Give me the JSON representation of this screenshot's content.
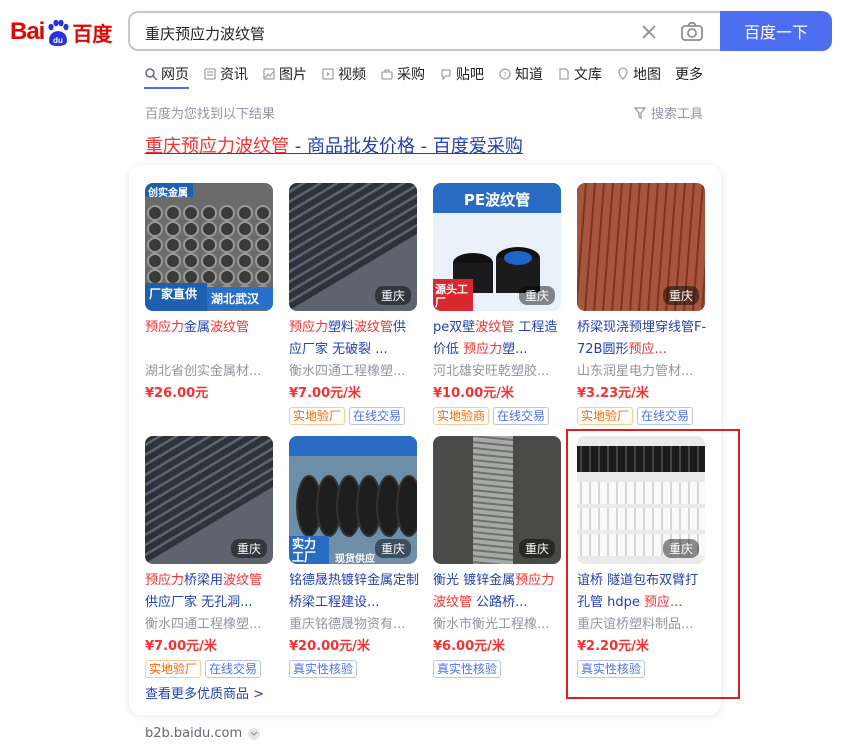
{
  "logo": {
    "bai": "Bai",
    "du": "du",
    "cn": "百度"
  },
  "search": {
    "query": "重庆预应力波纹管",
    "button": "百度一下"
  },
  "tabs": [
    {
      "label": "网页",
      "icon": "search-icon"
    },
    {
      "label": "资讯",
      "icon": "news-icon"
    },
    {
      "label": "图片",
      "icon": "image-icon"
    },
    {
      "label": "视频",
      "icon": "video-icon"
    },
    {
      "label": "采购",
      "icon": "bag-icon"
    },
    {
      "label": "贴吧",
      "icon": "tieba-icon"
    },
    {
      "label": "知道",
      "icon": "question-icon"
    },
    {
      "label": "文库",
      "icon": "doc-icon"
    },
    {
      "label": "地图",
      "icon": "map-icon"
    },
    {
      "label": "更多",
      "icon": ""
    }
  ],
  "results_info": {
    "count_text": "百度为您找到以下结果",
    "tools": "搜索工具"
  },
  "result": {
    "title_hl": "重庆预应力波纹管",
    "title_rest": " - 商品批发价格 - 百度爱采购",
    "more_link": "查看更多优质商品 >",
    "source": "b2b.baidu.com"
  },
  "products": [
    {
      "title": [
        [
          "预应力",
          "hl"
        ],
        [
          "金属",
          ""
        ],
        [
          "波纹管",
          "hl"
        ]
      ],
      "shop": "湖北省创实金属材...",
      "price": "¥26.00元",
      "location": "",
      "overlay_left": "厂家直供",
      "overlay_right": "湖北武汉",
      "corner": "创实金属",
      "badges": []
    },
    {
      "title": [
        [
          "预应力",
          "hl"
        ],
        [
          "塑料",
          ""
        ],
        [
          "波纹管",
          "hl"
        ],
        [
          "供应厂家 无破裂 ...",
          ""
        ]
      ],
      "shop": "衡水四通工程橡塑...",
      "price": "¥7.00元/米",
      "location": "重庆",
      "badges": [
        [
          "实地验厂",
          "orange"
        ],
        [
          "在线交易",
          "blue"
        ]
      ]
    },
    {
      "title": [
        [
          "pe双壁",
          ""
        ],
        [
          "波纹管",
          "hl"
        ],
        [
          " 工程造价低 ",
          ""
        ],
        [
          "预应力",
          "hl"
        ],
        [
          "塑...",
          ""
        ]
      ],
      "shop": "河北雄安旺乾塑胶...",
      "price": "¥10.00元/米",
      "location": "重庆",
      "pe_label": "PE波纹管",
      "overlay_left": "源头工厂",
      "badges": [
        [
          "实地验商",
          "orange"
        ],
        [
          "在线交易",
          "blue"
        ]
      ]
    },
    {
      "title": [
        [
          "桥梁现浇预埋穿线管F-72B圆形",
          ""
        ],
        [
          "预应...",
          "hl"
        ]
      ],
      "shop": "山东润星电力管材...",
      "price": "¥3.23元/米",
      "location": "重庆",
      "badges": [
        [
          "实地验厂",
          "orange"
        ],
        [
          "在线交易",
          "blue"
        ]
      ]
    },
    {
      "title": [
        [
          "预应力",
          "hl"
        ],
        [
          "桥梁用",
          ""
        ],
        [
          "波纹管",
          "hl"
        ],
        [
          "供应厂家 无孔洞...",
          ""
        ]
      ],
      "shop": "衡水四通工程橡塑...",
      "price": "¥7.00元/米",
      "location": "重庆",
      "badges": [
        [
          "实地验厂",
          "orange"
        ],
        [
          "在线交易",
          "blue"
        ]
      ]
    },
    {
      "title": [
        [
          "铭德晟热镀锌金属定制 桥梁工程建设...",
          ""
        ]
      ],
      "shop": "重庆铭德晟物资有...",
      "price": "¥20.00元/米",
      "location": "重庆",
      "overlay_left": "实力工厂",
      "overlay_bottom": "现货供应",
      "badges": [
        [
          "真实性核验",
          "blue"
        ]
      ]
    },
    {
      "title": [
        [
          "衡光 镀锌金属",
          ""
        ],
        [
          "预应力",
          "hl"
        ],
        [
          "波纹管",
          "hl"
        ],
        [
          " 公路桥...",
          ""
        ]
      ],
      "shop": "衡水市衡光工程橡...",
      "price": "¥6.00元/米",
      "location": "重庆",
      "badges": [
        [
          "真实性核验",
          "blue"
        ]
      ]
    },
    {
      "title": [
        [
          "谊桥 隧道包布双臂打孔管 hdpe ",
          ""
        ],
        [
          "预应...",
          "hl"
        ]
      ],
      "shop": "重庆谊桥塑料制品...",
      "price": "¥2.20元/米",
      "location": "重庆",
      "badges": [
        [
          "真实性核验",
          "blue"
        ]
      ]
    }
  ],
  "colors": {
    "accent": "#4e6ef2",
    "link": "#2440b3",
    "highlight": "#f73131",
    "annotation_box": "#e01e1e"
  }
}
